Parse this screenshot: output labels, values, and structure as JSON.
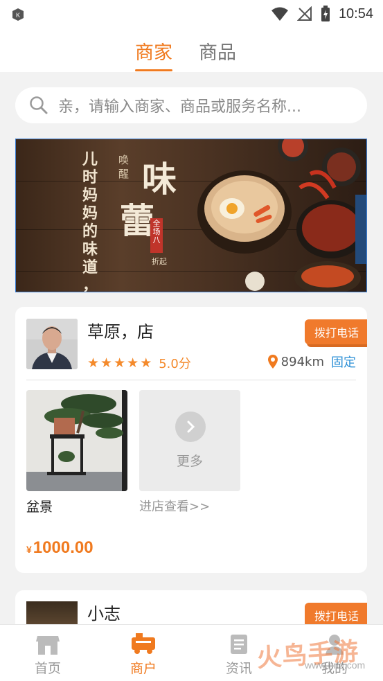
{
  "status_bar": {
    "time": "10:54"
  },
  "top_tabs": [
    {
      "label": "商家",
      "active": true
    },
    {
      "label": "商品",
      "active": false
    }
  ],
  "search": {
    "placeholder": "亲，请输入商家、商品或服务名称..."
  },
  "banner": {
    "line1": "儿时妈妈的味道，",
    "line2": "唤醒",
    "big1": "味",
    "big2": "蕾",
    "seal": "全场八",
    "small": "折起"
  },
  "merchants": [
    {
      "name": "草原，店",
      "call_label": "拨打电话",
      "rating_stars": 5,
      "score": "5.0分",
      "distance": "894km",
      "location_tag": "固定",
      "product_name": "盆景",
      "more_label": "更多",
      "enter_link": "进店查看>>",
      "currency": "¥",
      "price": "1000.00"
    },
    {
      "name": "小志",
      "call_label": "拨打电话"
    }
  ],
  "bottom_nav": [
    {
      "label": "首页",
      "icon": "home-store-icon",
      "active": false
    },
    {
      "label": "商户",
      "icon": "merchant-truck-icon",
      "active": true
    },
    {
      "label": "资讯",
      "icon": "news-document-icon",
      "active": false
    },
    {
      "label": "我的",
      "icon": "profile-icon",
      "active": false
    }
  ],
  "watermark": {
    "text": "火鸟手游网",
    "url": "www.hnq.com"
  },
  "colors": {
    "accent": "#f07a1f",
    "link": "#2b8fd6",
    "background": "#f2f2f2"
  }
}
